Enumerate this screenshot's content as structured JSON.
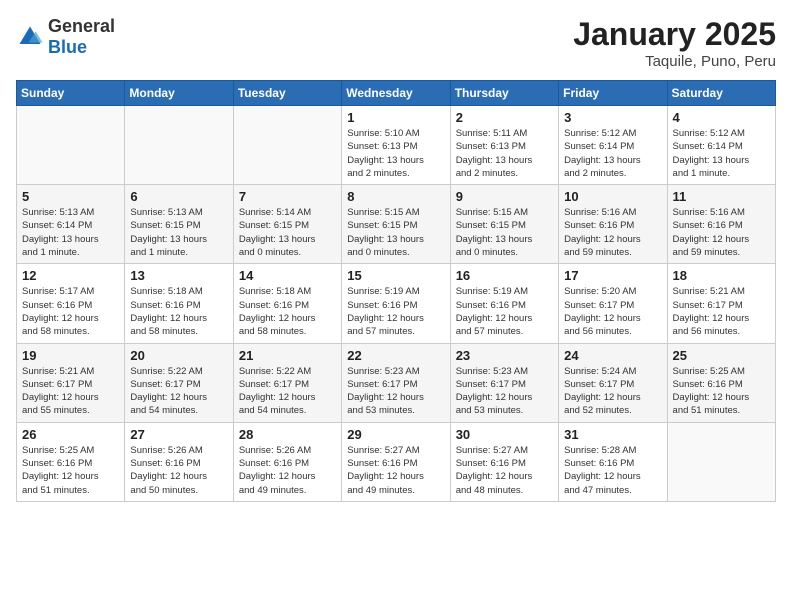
{
  "header": {
    "logo_general": "General",
    "logo_blue": "Blue",
    "title": "January 2025",
    "subtitle": "Taquile, Puno, Peru"
  },
  "weekdays": [
    "Sunday",
    "Monday",
    "Tuesday",
    "Wednesday",
    "Thursday",
    "Friday",
    "Saturday"
  ],
  "weeks": [
    [
      {
        "num": "",
        "info": ""
      },
      {
        "num": "",
        "info": ""
      },
      {
        "num": "",
        "info": ""
      },
      {
        "num": "1",
        "info": "Sunrise: 5:10 AM\nSunset: 6:13 PM\nDaylight: 13 hours\nand 2 minutes."
      },
      {
        "num": "2",
        "info": "Sunrise: 5:11 AM\nSunset: 6:13 PM\nDaylight: 13 hours\nand 2 minutes."
      },
      {
        "num": "3",
        "info": "Sunrise: 5:12 AM\nSunset: 6:14 PM\nDaylight: 13 hours\nand 2 minutes."
      },
      {
        "num": "4",
        "info": "Sunrise: 5:12 AM\nSunset: 6:14 PM\nDaylight: 13 hours\nand 1 minute."
      }
    ],
    [
      {
        "num": "5",
        "info": "Sunrise: 5:13 AM\nSunset: 6:14 PM\nDaylight: 13 hours\nand 1 minute."
      },
      {
        "num": "6",
        "info": "Sunrise: 5:13 AM\nSunset: 6:15 PM\nDaylight: 13 hours\nand 1 minute."
      },
      {
        "num": "7",
        "info": "Sunrise: 5:14 AM\nSunset: 6:15 PM\nDaylight: 13 hours\nand 0 minutes."
      },
      {
        "num": "8",
        "info": "Sunrise: 5:15 AM\nSunset: 6:15 PM\nDaylight: 13 hours\nand 0 minutes."
      },
      {
        "num": "9",
        "info": "Sunrise: 5:15 AM\nSunset: 6:15 PM\nDaylight: 13 hours\nand 0 minutes."
      },
      {
        "num": "10",
        "info": "Sunrise: 5:16 AM\nSunset: 6:16 PM\nDaylight: 12 hours\nand 59 minutes."
      },
      {
        "num": "11",
        "info": "Sunrise: 5:16 AM\nSunset: 6:16 PM\nDaylight: 12 hours\nand 59 minutes."
      }
    ],
    [
      {
        "num": "12",
        "info": "Sunrise: 5:17 AM\nSunset: 6:16 PM\nDaylight: 12 hours\nand 58 minutes."
      },
      {
        "num": "13",
        "info": "Sunrise: 5:18 AM\nSunset: 6:16 PM\nDaylight: 12 hours\nand 58 minutes."
      },
      {
        "num": "14",
        "info": "Sunrise: 5:18 AM\nSunset: 6:16 PM\nDaylight: 12 hours\nand 58 minutes."
      },
      {
        "num": "15",
        "info": "Sunrise: 5:19 AM\nSunset: 6:16 PM\nDaylight: 12 hours\nand 57 minutes."
      },
      {
        "num": "16",
        "info": "Sunrise: 5:19 AM\nSunset: 6:16 PM\nDaylight: 12 hours\nand 57 minutes."
      },
      {
        "num": "17",
        "info": "Sunrise: 5:20 AM\nSunset: 6:17 PM\nDaylight: 12 hours\nand 56 minutes."
      },
      {
        "num": "18",
        "info": "Sunrise: 5:21 AM\nSunset: 6:17 PM\nDaylight: 12 hours\nand 56 minutes."
      }
    ],
    [
      {
        "num": "19",
        "info": "Sunrise: 5:21 AM\nSunset: 6:17 PM\nDaylight: 12 hours\nand 55 minutes."
      },
      {
        "num": "20",
        "info": "Sunrise: 5:22 AM\nSunset: 6:17 PM\nDaylight: 12 hours\nand 54 minutes."
      },
      {
        "num": "21",
        "info": "Sunrise: 5:22 AM\nSunset: 6:17 PM\nDaylight: 12 hours\nand 54 minutes."
      },
      {
        "num": "22",
        "info": "Sunrise: 5:23 AM\nSunset: 6:17 PM\nDaylight: 12 hours\nand 53 minutes."
      },
      {
        "num": "23",
        "info": "Sunrise: 5:23 AM\nSunset: 6:17 PM\nDaylight: 12 hours\nand 53 minutes."
      },
      {
        "num": "24",
        "info": "Sunrise: 5:24 AM\nSunset: 6:17 PM\nDaylight: 12 hours\nand 52 minutes."
      },
      {
        "num": "25",
        "info": "Sunrise: 5:25 AM\nSunset: 6:16 PM\nDaylight: 12 hours\nand 51 minutes."
      }
    ],
    [
      {
        "num": "26",
        "info": "Sunrise: 5:25 AM\nSunset: 6:16 PM\nDaylight: 12 hours\nand 51 minutes."
      },
      {
        "num": "27",
        "info": "Sunrise: 5:26 AM\nSunset: 6:16 PM\nDaylight: 12 hours\nand 50 minutes."
      },
      {
        "num": "28",
        "info": "Sunrise: 5:26 AM\nSunset: 6:16 PM\nDaylight: 12 hours\nand 49 minutes."
      },
      {
        "num": "29",
        "info": "Sunrise: 5:27 AM\nSunset: 6:16 PM\nDaylight: 12 hours\nand 49 minutes."
      },
      {
        "num": "30",
        "info": "Sunrise: 5:27 AM\nSunset: 6:16 PM\nDaylight: 12 hours\nand 48 minutes."
      },
      {
        "num": "31",
        "info": "Sunrise: 5:28 AM\nSunset: 6:16 PM\nDaylight: 12 hours\nand 47 minutes."
      },
      {
        "num": "",
        "info": ""
      }
    ]
  ]
}
